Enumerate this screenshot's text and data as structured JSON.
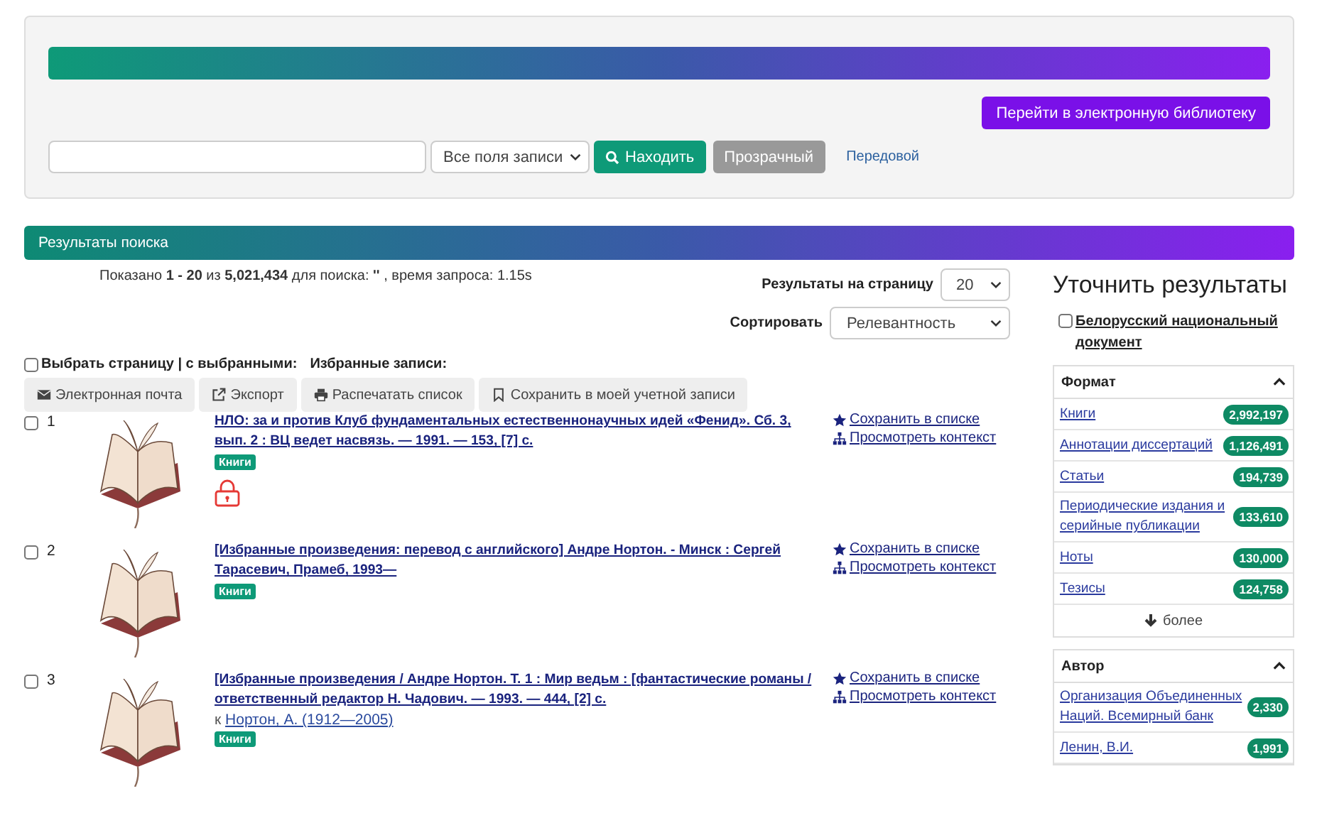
{
  "header": {
    "library_button": "Перейти в электронную библиотеку",
    "search": {
      "field_select": "Все поля записи",
      "search_button": "Находить",
      "clear_button": "Прозрачный",
      "advanced_link": "Передовой"
    }
  },
  "results_bar": {
    "title": "Результаты поиска"
  },
  "summary": "Показано **1 - 20** из **5,021,434** для поиска: **''** , время запроса: 1.15s",
  "per_page": {
    "label": "Результаты на страницу",
    "value": "20"
  },
  "sort": {
    "label": "Сортировать",
    "value": "Релевантность"
  },
  "select_page": {
    "label": "Выбрать страницу | с выбранными:",
    "checked": false
  },
  "favorites_label": "Избранные записи:",
  "actions": [
    {
      "kind": "email",
      "label": "Электронная почта"
    },
    {
      "kind": "export",
      "label": "Экспорт"
    },
    {
      "kind": "print",
      "label": "Распечатать список"
    },
    {
      "kind": "bookmark",
      "label": "Сохранить в моей учетной записи"
    }
  ],
  "records": [
    {
      "number": "1",
      "checked": false,
      "title": "НЛО: за и против Клуб фундаментальных естественнонаучных идей «Фенид». Сб. 3, вып. 2 : ВЦ ведет насвязь. — 1991. — 153, [7] с.",
      "format": "Книги",
      "locked": true,
      "links": [
        {
          "kind": "star",
          "label": "Сохранить в списке"
        },
        {
          "kind": "tree",
          "label": "Просмотреть контекст"
        }
      ]
    },
    {
      "number": "2",
      "checked": false,
      "title": "[Избранные произведения: перевод с английского] Андре Нортон. - Минск : Сергей Тарасевич, Прамеб, 1993—",
      "format": "Книги",
      "locked": false,
      "links": [
        {
          "kind": "star",
          "label": "Сохранить в списке"
        },
        {
          "kind": "tree",
          "label": "Просмотреть контекст"
        }
      ]
    },
    {
      "number": "3",
      "checked": false,
      "title": "[Избранные произведения / Андре Нортон. Т. 1 : Мир ведьм : [фантастические романы / ответственный редактор Н. Чадович. — 1993. — 444, [2] с.",
      "author_prefix": "к",
      "author": "Нортон, А. (1912—2005)",
      "format": "Книги",
      "locked": false,
      "links": [
        {
          "kind": "star",
          "label": "Сохранить в списке"
        },
        {
          "kind": "tree",
          "label": "Просмотреть контекст"
        }
      ]
    }
  ],
  "sidebar": {
    "title": "Уточнить результаты",
    "national_filter": {
      "label": "Белорусский национальный документ",
      "checked": false
    },
    "facets": [
      {
        "title": "Формат",
        "expanded": true,
        "more": "более",
        "items": [
          {
            "label": "Книги",
            "count": "2,992,197"
          },
          {
            "label": "Аннотации диссертаций",
            "count": "1,126,491"
          },
          {
            "label": "Статьи",
            "count": "194,739"
          },
          {
            "label": "Периодические издания и серийные публикации",
            "count": "133,610"
          },
          {
            "label": "Ноты",
            "count": "130,000"
          },
          {
            "label": "Тезисы",
            "count": "124,758"
          }
        ]
      },
      {
        "title": "Автор",
        "expanded": true,
        "items": [
          {
            "label": "Организация Объединенных Наций. Всемирный банк",
            "count": "2,330"
          },
          {
            "label": "Ленин, В.И.",
            "count": "1,991"
          }
        ]
      }
    ]
  }
}
